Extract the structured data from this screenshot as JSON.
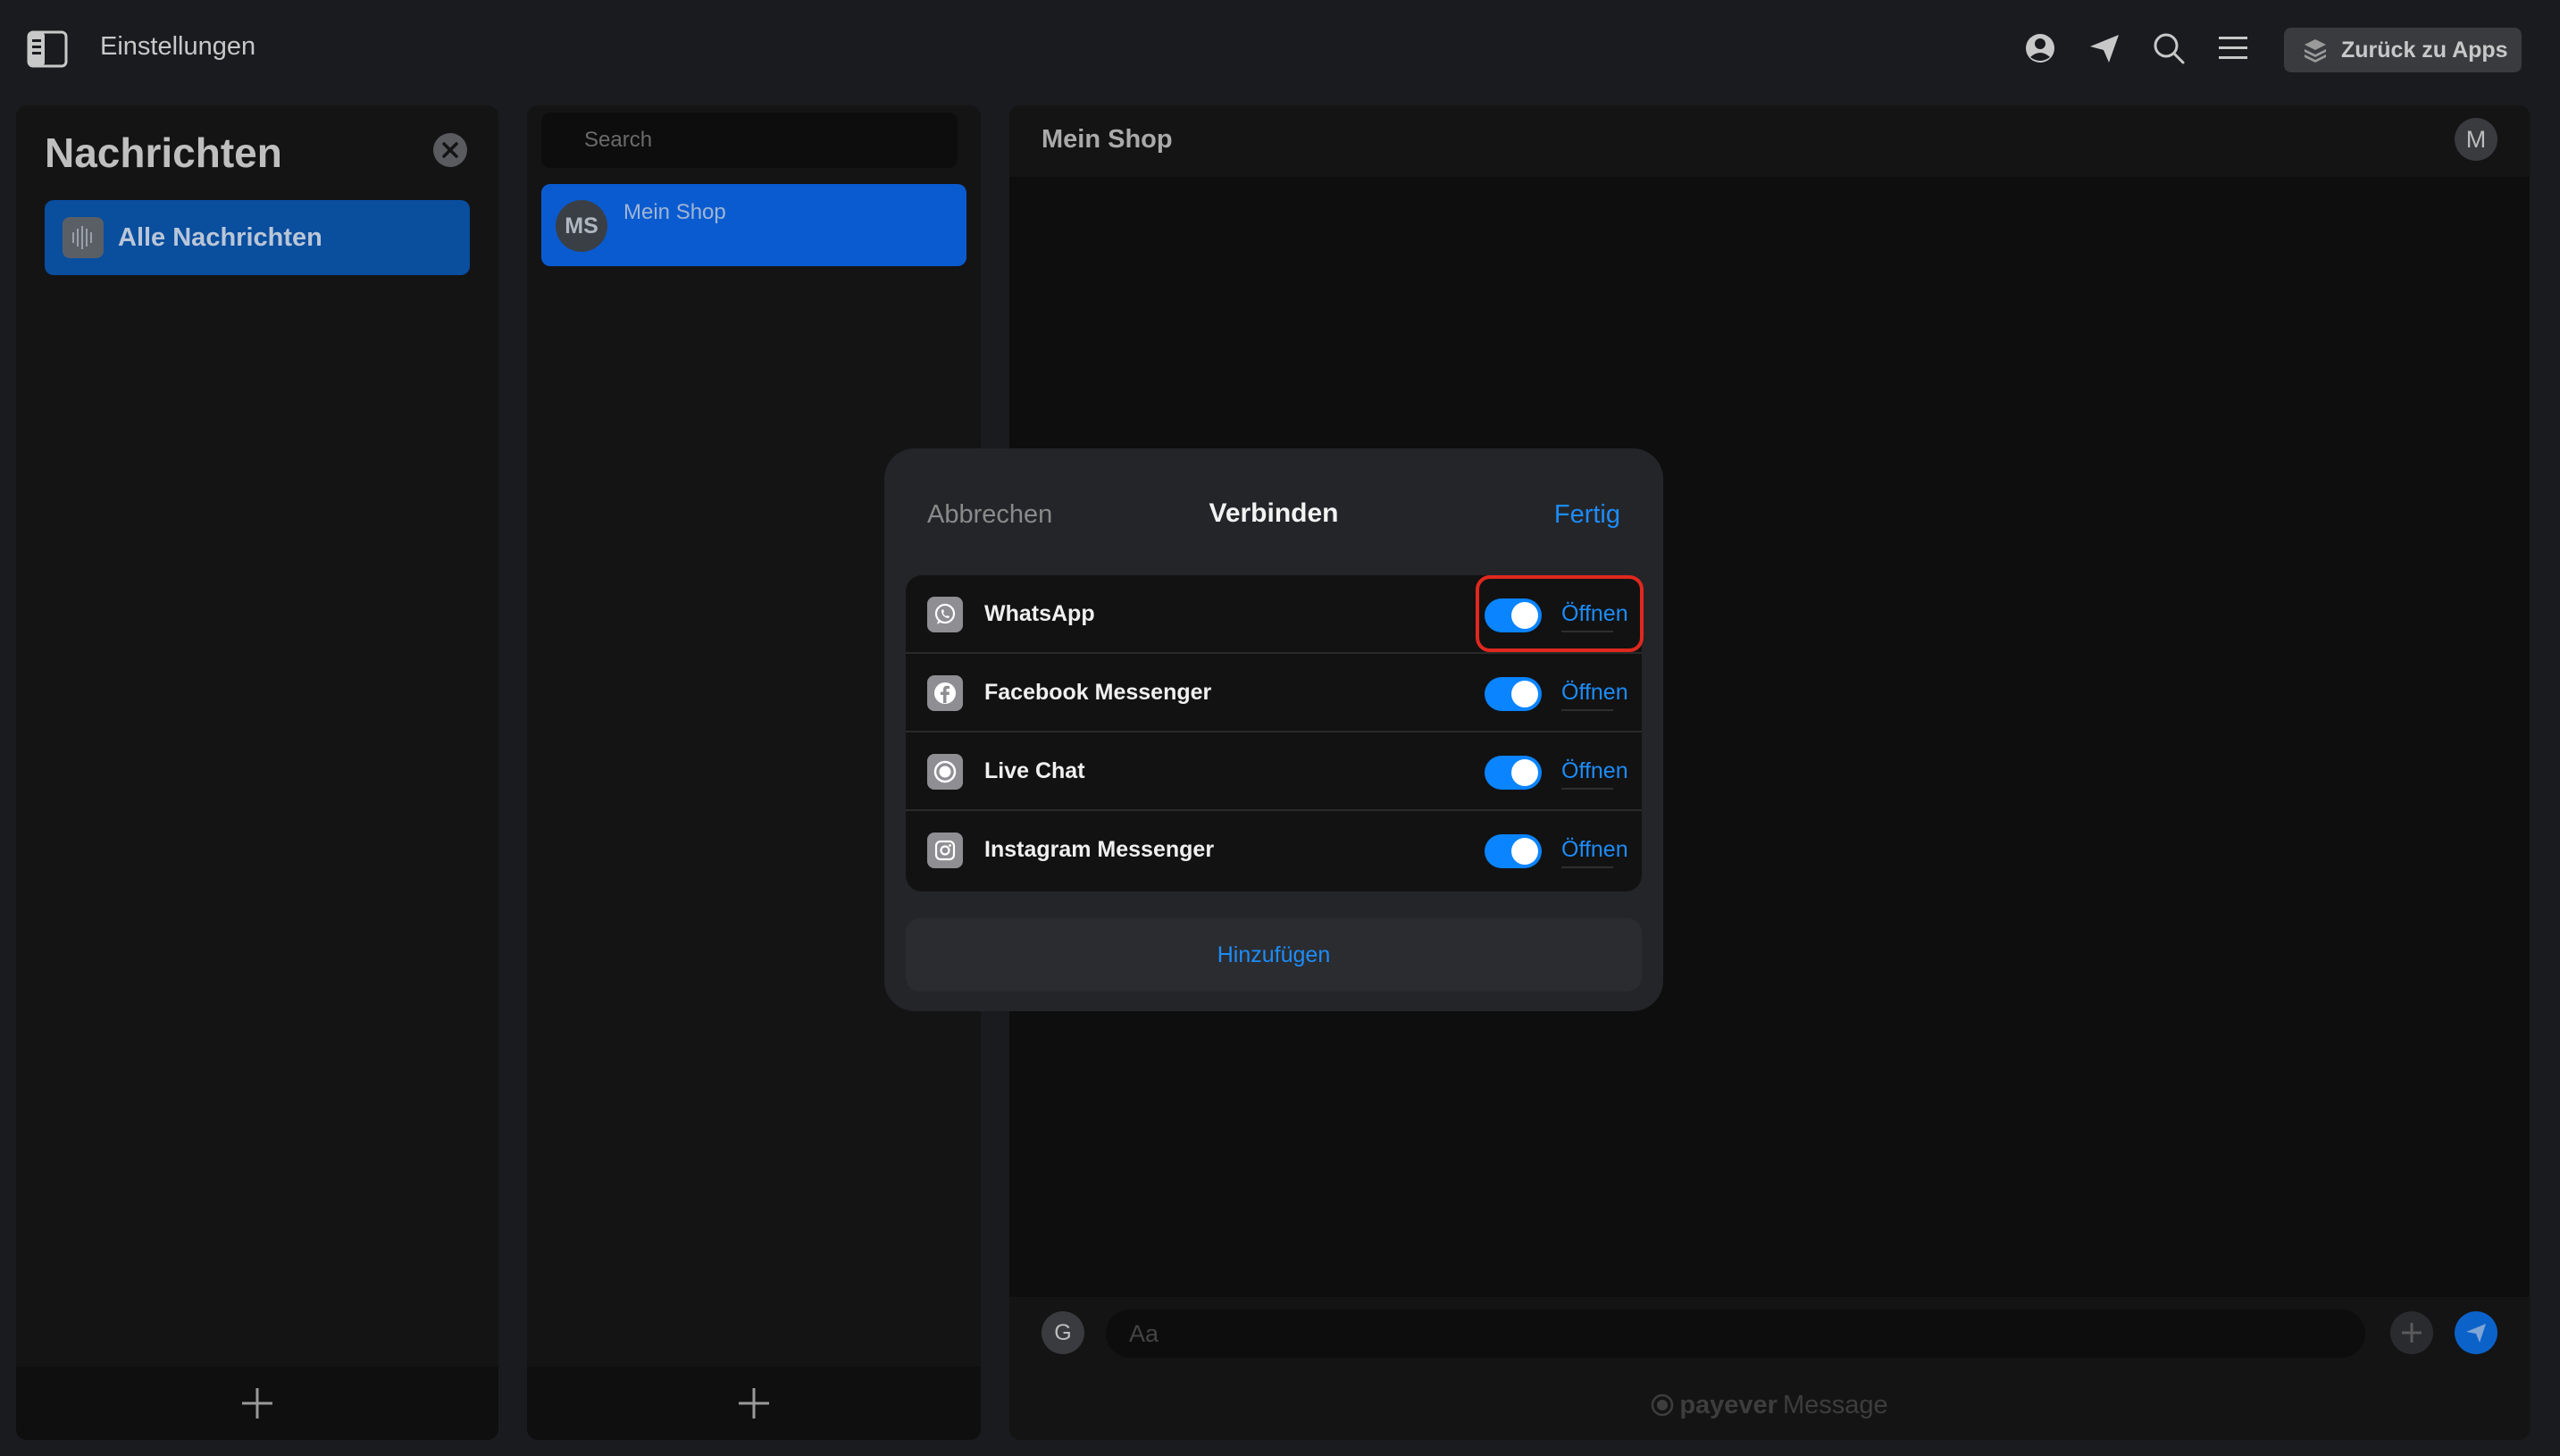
{
  "topbar": {
    "title": "Einstellungen",
    "back_label": "Zurück zu Apps",
    "icons": [
      "sidebar-toggle-icon",
      "profile-icon",
      "send-icon",
      "search-icon",
      "menu-icon",
      "apps-stack-icon"
    ]
  },
  "folders": {
    "title": "Nachrichten",
    "items": [
      {
        "label": "Alle Nachrichten",
        "icon": "audio-wave-icon",
        "active": true
      }
    ]
  },
  "conversations": {
    "search_placeholder": "Search",
    "items": [
      {
        "initials": "MS",
        "name": "Mein Shop",
        "active": true
      }
    ]
  },
  "chat": {
    "title": "Mein Shop",
    "user_initial": "M",
    "composer_initial": "G",
    "input_placeholder": "Aa",
    "brand_name": "payever",
    "brand_suffix": "Message"
  },
  "modal": {
    "cancel_label": "Abbrechen",
    "title": "Verbinden",
    "done_label": "Fertig",
    "add_label": "Hinzufügen",
    "integrations": [
      {
        "label": "WhatsApp",
        "icon": "whatsapp-icon",
        "enabled": true,
        "open_label": "Öffnen",
        "highlighted": true
      },
      {
        "label": "Facebook Messenger",
        "icon": "facebook-icon",
        "enabled": true,
        "open_label": "Öffnen",
        "highlighted": false
      },
      {
        "label": "Live Chat",
        "icon": "live-chat-icon",
        "enabled": true,
        "open_label": "Öffnen",
        "highlighted": false
      },
      {
        "label": "Instagram Messenger",
        "icon": "instagram-icon",
        "enabled": true,
        "open_label": "Öffnen",
        "highlighted": false
      }
    ]
  },
  "colors": {
    "accent": "#1d8cf8",
    "toggle_on": "#0a84ff",
    "highlight": "#e0281e",
    "active_item": "#0a5bd0"
  }
}
